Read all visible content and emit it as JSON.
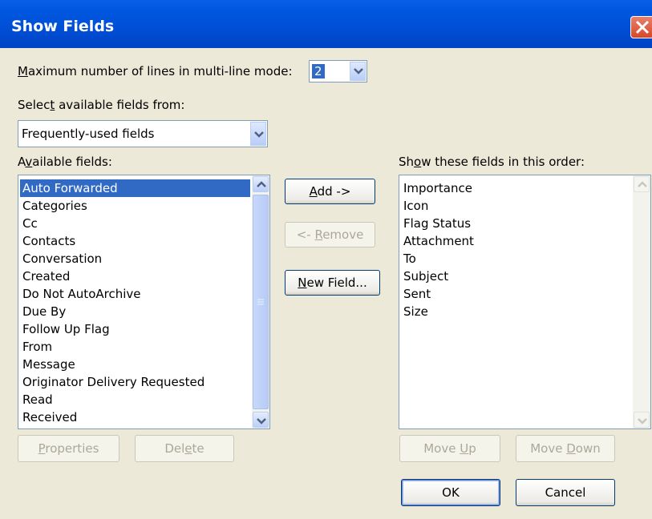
{
  "window": {
    "title": "Show Fields"
  },
  "max_lines": {
    "label_prefix": "",
    "label_accel": "M",
    "label_rest": "aximum number of lines in multi-line mode:",
    "value": "2"
  },
  "select_from": {
    "label_pre": "Selec",
    "label_accel": "t",
    "label_post": " available fields from:",
    "value": "Frequently-used fields"
  },
  "available": {
    "label_pre": "A",
    "label_accel": "v",
    "label_post": "ailable fields:",
    "items": [
      "Auto Forwarded",
      "Categories",
      "Cc",
      "Contacts",
      "Conversation",
      "Created",
      "Do Not AutoArchive",
      "Due By",
      "Follow Up Flag",
      "From",
      "Message",
      "Originator Delivery Requested",
      "Read",
      "Received"
    ],
    "selected_index": 0
  },
  "shown": {
    "label_pre": "Sh",
    "label_accel": "o",
    "label_post": "w these fields in this order:",
    "items": [
      "Importance",
      "Icon",
      "Flag Status",
      "Attachment",
      "To",
      "Subject",
      "Sent",
      "Size"
    ]
  },
  "buttons": {
    "add": {
      "accel": "A",
      "rest": "dd ->"
    },
    "remove": {
      "pre": "<- ",
      "accel": "R",
      "rest": "emove"
    },
    "new_field": {
      "accel": "N",
      "rest": "ew Field..."
    },
    "properties": {
      "accel": "P",
      "rest": "roperties"
    },
    "delete": {
      "pre": "Del",
      "accel": "e",
      "rest": "te"
    },
    "move_up": {
      "pre": "Move ",
      "accel": "U",
      "rest": "p"
    },
    "move_down": {
      "pre": "Move ",
      "accel": "D",
      "rest": "own"
    },
    "ok": "OK",
    "cancel": "Cancel"
  },
  "colors": {
    "title_bar": "#0054e3",
    "selection": "#316ac5",
    "dialog_bg": "#ece9d8",
    "close_button": "#d6472a"
  }
}
